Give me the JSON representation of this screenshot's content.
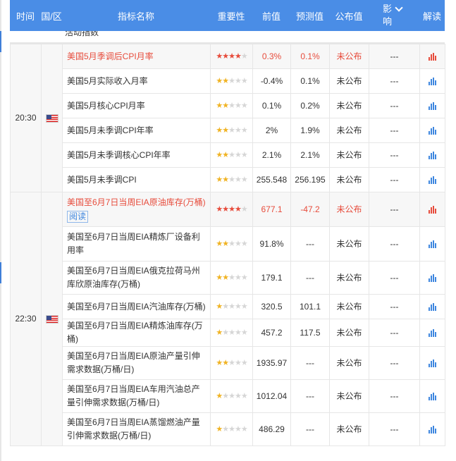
{
  "header": {
    "time": "时间",
    "region": "国/区",
    "indicator": "指标名称",
    "importance": "重要性",
    "previous": "前值",
    "forecast": "预测值",
    "actual": "公布值",
    "impact": "影\n响",
    "interpret": "解读"
  },
  "partial_row_text": "活动指数",
  "read_label": "阅读",
  "groups": [
    {
      "time": "20:30",
      "country_icon": "us-flag-icon",
      "rows": [
        {
          "name": "美国5月季调后CPI月率",
          "stars": 4,
          "prev": "0.3%",
          "forecast": "0.1%",
          "actual": "未公布",
          "impact": "---",
          "highlight": true
        },
        {
          "name": "美国5月实际收入月率",
          "stars": 2,
          "prev": "-0.4%",
          "forecast": "0.1%",
          "actual": "未公布",
          "impact": "---"
        },
        {
          "name": "美国5月核心CPI月率",
          "stars": 2,
          "prev": "0.1%",
          "forecast": "0.2%",
          "actual": "未公布",
          "impact": "---"
        },
        {
          "name": "美国5月未季调CPI年率",
          "stars": 2,
          "prev": "2%",
          "forecast": "1.9%",
          "actual": "未公布",
          "impact": "---"
        },
        {
          "name": "美国5月未季调核心CPI年率",
          "stars": 2,
          "prev": "2.1%",
          "forecast": "2.1%",
          "actual": "未公布",
          "impact": "---"
        },
        {
          "name": "美国5月未季调CPI",
          "stars": 2,
          "prev": "255.548",
          "forecast": "256.195",
          "actual": "未公布",
          "impact": "---"
        }
      ]
    },
    {
      "time": "22:30",
      "country_icon": "us-flag-icon",
      "rows": [
        {
          "name": "美国至6月7日当周EIA原油库存(万桶)",
          "stars": 4,
          "prev": "677.1",
          "forecast": "-47.2",
          "actual": "未公布",
          "impact": "---",
          "highlight": true,
          "read": true
        },
        {
          "name": "美国至6月7日当周EIA精炼厂设备利用率",
          "stars": 2,
          "prev": "91.8%",
          "forecast": "---",
          "actual": "未公布",
          "impact": "---"
        },
        {
          "name": "美国至6月7日当周EIA俄克拉荷马州库欣原油库存(万桶)",
          "stars": 2,
          "prev": "179.1",
          "forecast": "---",
          "actual": "未公布",
          "impact": "---"
        },
        {
          "name": "美国至6月7日当周EIA汽油库存(万桶)",
          "stars": 1,
          "prev": "320.5",
          "forecast": "101.1",
          "actual": "未公布",
          "impact": "---"
        },
        {
          "name": "美国至6月7日当周EIA精炼油库存(万桶)",
          "stars": 1,
          "prev": "457.2",
          "forecast": "117.5",
          "actual": "未公布",
          "impact": "---"
        },
        {
          "name": "美国至6月7日当周EIA原油产量引伸需求数据(万桶/日)",
          "stars": 2,
          "prev": "1935.97",
          "forecast": "---",
          "actual": "未公布",
          "impact": "---"
        },
        {
          "name": "美国至6月7日当周EIA车用汽油总产量引伸需求数据(万桶/日)",
          "stars": 1,
          "prev": "1012.04",
          "forecast": "---",
          "actual": "未公布",
          "impact": "---"
        },
        {
          "name": "美国至6月7日当周EIA蒸馏燃油产量引伸需求数据(万桶/日)",
          "stars": 1,
          "prev": "486.29",
          "forecast": "---",
          "actual": "未公布",
          "impact": "---"
        }
      ]
    }
  ],
  "colors": {
    "header_bg": "#4a8de6",
    "star_on": "#f0b323",
    "star_hot": "#e74c3c",
    "highlight_text": "#e74c3c",
    "link_blue": "#3d86df"
  }
}
